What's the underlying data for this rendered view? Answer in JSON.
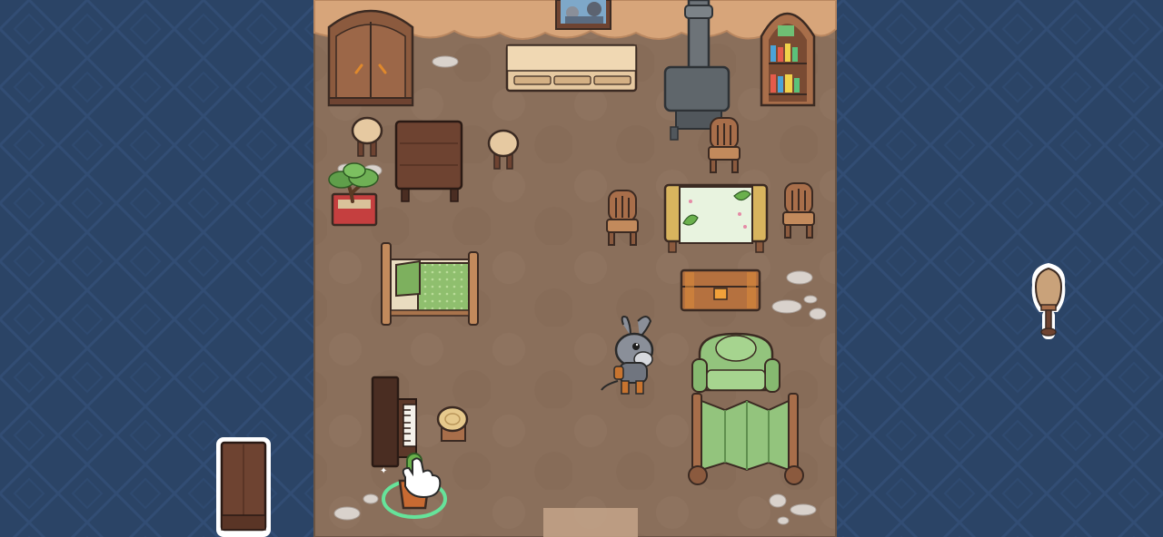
{
  "scene": {
    "name": "cozy-cabin-decorating",
    "colors": {
      "ocean": "#2b4466",
      "ocean_pattern": "#34507a",
      "floor": "#8a6f5b",
      "floor_light": "#957a64",
      "wall": "#d7a57a",
      "wood_dark": "#6e4331",
      "wood_mid": "#8b5a3e",
      "wood_light": "#c99a6c",
      "leaf_green": "#8fbf6e",
      "sofa_green": "#93c47d",
      "selection_ring": "#66e39a",
      "outline": "#3b2a22"
    }
  },
  "room": {
    "wall_items": [
      {
        "name": "wardrobe",
        "icon": "wardrobe-icon"
      },
      {
        "name": "wall-portrait",
        "icon": "portrait-icon"
      },
      {
        "name": "low-sideboard",
        "icon": "sideboard-icon"
      },
      {
        "name": "wood-stove",
        "icon": "stove-icon"
      },
      {
        "name": "arched-bookcase",
        "icon": "bookcase-icon"
      }
    ],
    "furniture": [
      {
        "name": "round-stool-left",
        "interactable": true
      },
      {
        "name": "dark-square-table",
        "interactable": true
      },
      {
        "name": "round-stool-right",
        "interactable": true
      },
      {
        "name": "potted-bonsai",
        "interactable": true
      },
      {
        "name": "green-quilt-bed",
        "interactable": true
      },
      {
        "name": "dining-chairs",
        "interactable": true
      },
      {
        "name": "leaf-tablecloth-table",
        "interactable": true
      },
      {
        "name": "wooden-chest",
        "interactable": true
      },
      {
        "name": "green-sofa",
        "interactable": true
      },
      {
        "name": "folding-screen",
        "interactable": true
      },
      {
        "name": "upright-piano",
        "interactable": true
      },
      {
        "name": "tree-stump-stool",
        "interactable": true
      },
      {
        "name": "potted-cactus-selected",
        "interactable": true
      }
    ]
  },
  "character": {
    "name": "grey-donkey-player",
    "icon": "donkey-icon"
  },
  "inventory_held": [
    {
      "name": "held-floor-lamp",
      "icon": "lamp-icon"
    },
    {
      "name": "held-tall-shelf",
      "icon": "shelf-icon"
    }
  ],
  "cursor": {
    "icon": "hand-pointer-icon"
  }
}
